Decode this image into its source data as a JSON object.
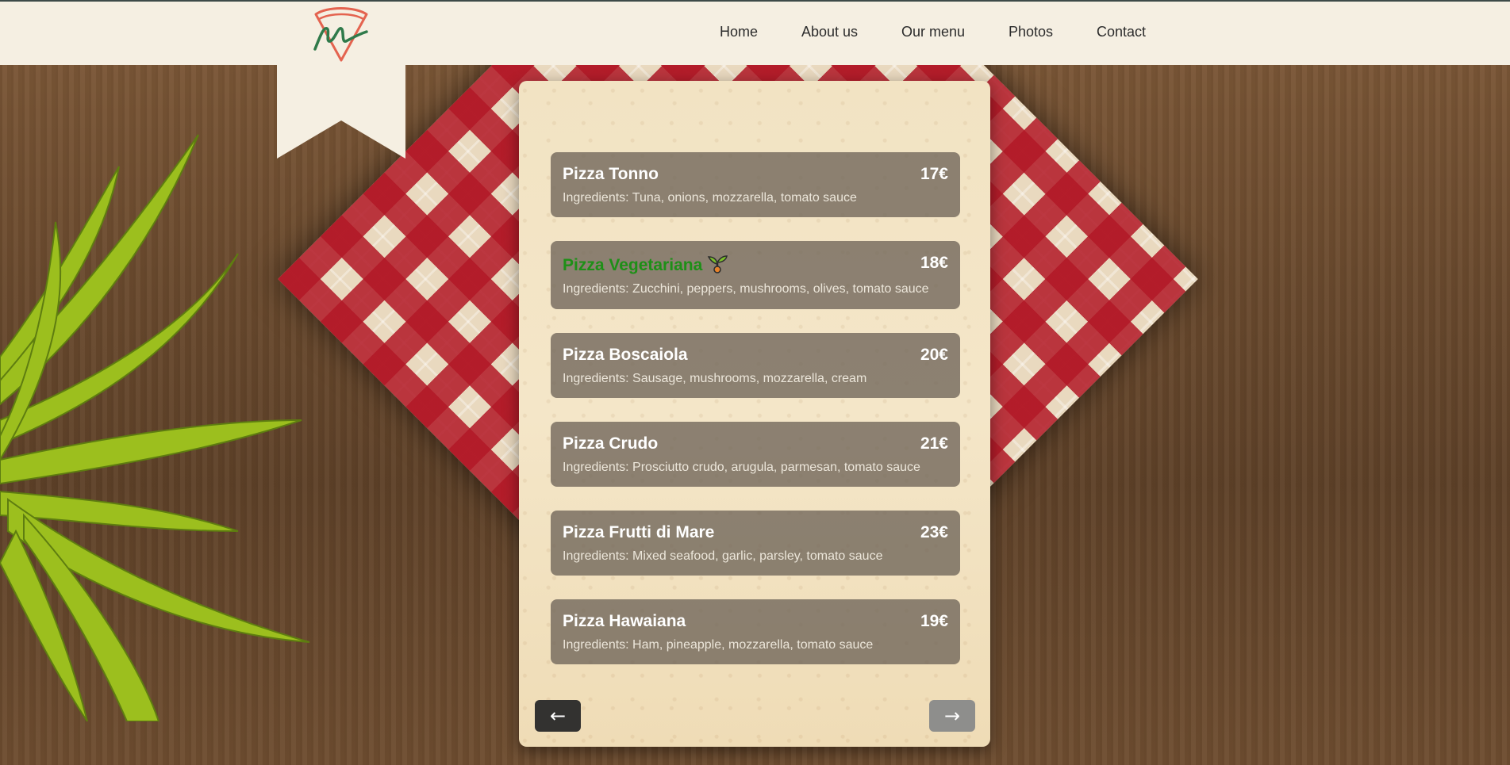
{
  "header": {
    "nav": [
      {
        "label": "Home"
      },
      {
        "label": "About us"
      },
      {
        "label": "Our menu"
      },
      {
        "label": "Photos"
      },
      {
        "label": "Contact"
      }
    ]
  },
  "menu": {
    "items": [
      {
        "name": "Pizza Tonno",
        "price": "17€",
        "ingredients": "Ingredients: Tuna, onions, mozzarella, tomato sauce",
        "vegetarian": false
      },
      {
        "name": "Pizza Vegetariana",
        "price": "18€",
        "ingredients": "Ingredients: Zucchini, peppers, mushrooms, olives, tomato sauce",
        "vegetarian": true
      },
      {
        "name": "Pizza Boscaiola",
        "price": "20€",
        "ingredients": "Ingredients: Sausage, mushrooms, mozzarella, cream",
        "vegetarian": false
      },
      {
        "name": "Pizza Crudo",
        "price": "21€",
        "ingredients": "Ingredients: Prosciutto crudo, arugula, parmesan, tomato sauce",
        "vegetarian": false
      },
      {
        "name": "Pizza Frutti di Mare",
        "price": "23€",
        "ingredients": "Ingredients: Mixed seafood, garlic, parsley, tomato sauce",
        "vegetarian": false
      },
      {
        "name": "Pizza Hawaiana",
        "price": "19€",
        "ingredients": "Ingredients: Ham, pineapple, mozzarella, tomato sauce",
        "vegetarian": false
      }
    ],
    "prev_label": "←",
    "next_label": "→"
  },
  "colors": {
    "header_bg": "#f5efe2",
    "vegetarian_name": "#1e8f17",
    "prev_button": "#333230",
    "next_button": "#8e8e8c"
  },
  "icons": {
    "logo": "pizza-slice-logo-icon",
    "vegetarian": "sprout-icon"
  }
}
